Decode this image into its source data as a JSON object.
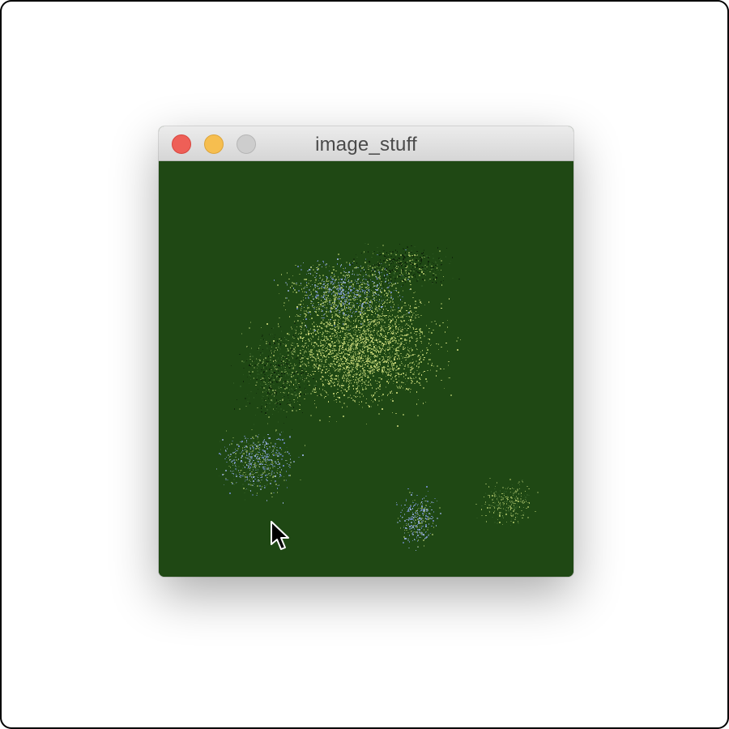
{
  "window": {
    "title": "image_stuff",
    "buttons": {
      "close": "close-icon",
      "minimize": "minimize-icon",
      "zoom": "zoom-icon"
    }
  },
  "canvas": {
    "background_color": "#1f4814",
    "speckle_colors": [
      "#c7d27a",
      "#9fb860",
      "#7f9c52",
      "#6a86b8",
      "#8fa8d0",
      "#2f5a22",
      "#0e250a",
      "#b8c96d"
    ]
  },
  "cursor": {
    "icon": "arrow-pointer-icon"
  }
}
